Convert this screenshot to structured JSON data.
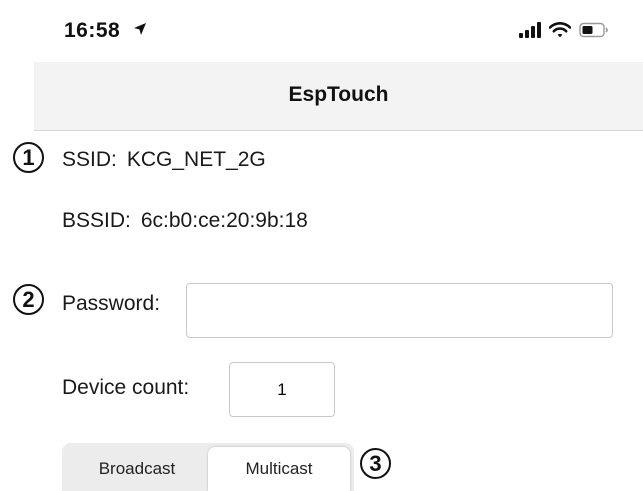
{
  "status_bar": {
    "time": "16:58",
    "icons": [
      "location-arrow-icon",
      "cellular-signal-icon",
      "wifi-icon",
      "battery-icon"
    ]
  },
  "nav": {
    "title": "EspTouch"
  },
  "markers": [
    "1",
    "2",
    "3"
  ],
  "wifi": {
    "ssid_label": "SSID:",
    "ssid_value": "KCG_NET_2G",
    "bssid_label": "BSSID:",
    "bssid_value": "6c:b0:ce:20:9b:18"
  },
  "form": {
    "password_label": "Password:",
    "password_value": "",
    "device_count_label": "Device count:",
    "device_count_value": "1"
  },
  "mode": {
    "options": [
      "Broadcast",
      "Multicast"
    ],
    "selected": "Multicast"
  }
}
